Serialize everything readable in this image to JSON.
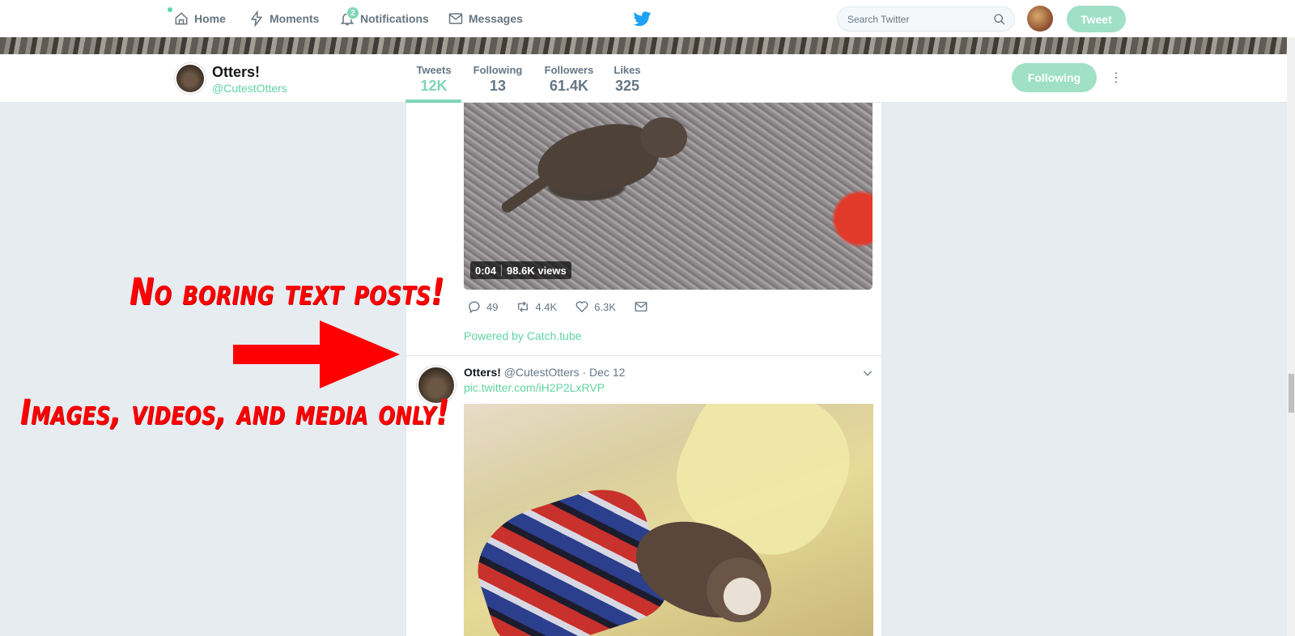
{
  "nav": {
    "home": "Home",
    "moments": "Moments",
    "notifications": "Notifications",
    "notifications_count": "2",
    "messages": "Messages",
    "search_placeholder": "Search Twitter",
    "tweet_button": "Tweet"
  },
  "profile": {
    "name": "Otters!",
    "handle": "@CutestOtters",
    "stats": [
      {
        "label": "Tweets",
        "value": "12K"
      },
      {
        "label": "Following",
        "value": "13"
      },
      {
        "label": "Followers",
        "value": "61.4K"
      },
      {
        "label": "Likes",
        "value": "325"
      }
    ],
    "following_button": "Following"
  },
  "tweet1": {
    "video_duration": "0:04",
    "video_views": "98.6K views",
    "replies": "49",
    "retweets": "4.4K",
    "likes": "6.3K",
    "powered_by": "Powered by Catch.tube"
  },
  "tweet2": {
    "name": "Otters!",
    "meta": "@CutestOtters · Dec 12",
    "link": "pic.twitter.com/iH2P2LxRVP"
  },
  "annotations": {
    "top": "No boring text posts!",
    "bottom": "Images, videos, and media only!"
  },
  "colors": {
    "accent": "#7fd6b4",
    "annotation": "#ff0000",
    "background": "#e6ecf0"
  }
}
